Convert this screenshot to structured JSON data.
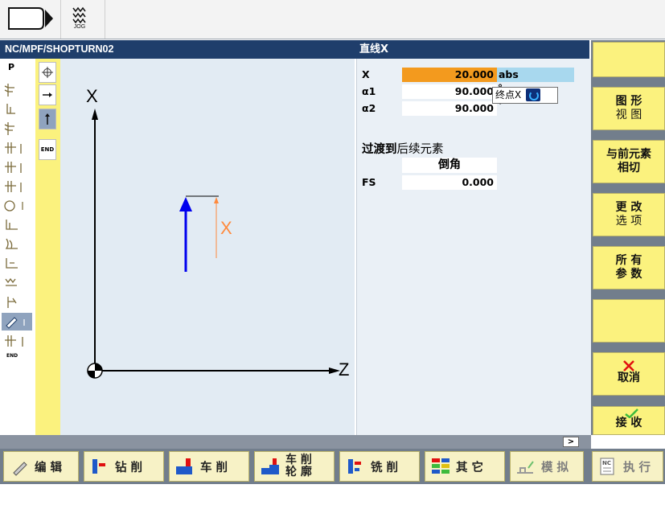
{
  "topbar": {
    "mode_icon": "operating-area-icon",
    "jog_label": "JOG"
  },
  "program": {
    "path": "NC/MPF/SHOPTURN02"
  },
  "left_strip": {
    "items": [
      "P",
      "turn-icon",
      "step-icon",
      "turn-icon",
      "drill-icon",
      "drill-icon",
      "drill-icon",
      "circle-icon",
      "contour-icon",
      "contour-icon",
      "contour-icon",
      "thread-icon",
      "contour-icon",
      "pencil-icon-active",
      "drill-icon",
      "END"
    ]
  },
  "contour_tools": [
    {
      "icon": "circle-target-icon"
    },
    {
      "icon": "arrow-right-icon"
    },
    {
      "icon": "arrow-up-icon",
      "active": true
    },
    {
      "icon": "end-icon",
      "label": "END"
    }
  ],
  "graphic": {
    "x_axis_label": "X",
    "z_axis_label": "Z",
    "element_label": "X"
  },
  "form": {
    "title": "直线X",
    "fields": [
      {
        "label": "X",
        "value": "20.000",
        "unit": "abs",
        "highlighted": true
      },
      {
        "label": "α1",
        "value": "90.000",
        "unit": "°"
      },
      {
        "label": "α2",
        "value": "90.000",
        "unit": "°"
      }
    ],
    "transition_title_1": "过渡到",
    "transition_title_2": "后续元素",
    "transition_type": "倒角",
    "fs_label": "FS",
    "fs_value": "0.000",
    "tooltip_label": "终点X",
    "colors": {
      "highlight": "#f39a1e",
      "header": "#1f3e6b",
      "unit_bg": "#a8d8ee"
    }
  },
  "softkeys": [
    {
      "line1": "",
      "line2": ""
    },
    {
      "line1": "图 形",
      "line2": "视 图"
    },
    {
      "line1": "与前元素",
      "line2": "相切"
    },
    {
      "line1": "更 改",
      "line2": "选 项"
    },
    {
      "line1": "所 有",
      "line2": "参 数"
    },
    {
      "line1": "",
      "line2": ""
    },
    {
      "line1": "取消",
      "line2": "",
      "icon": "cancel-x-icon"
    },
    {
      "line1": "接 收",
      "line2": "",
      "icon": "check-icon"
    }
  ],
  "scroll": {
    "label": ">"
  },
  "bottom": {
    "edit": "编 辑",
    "drill": "钻 削",
    "turn": "车 削",
    "contour_1": "车 削",
    "contour_2": "轮 廓",
    "mill": "铣 削",
    "other": "其 它",
    "simulate": "模 拟",
    "execute": "执 行"
  }
}
